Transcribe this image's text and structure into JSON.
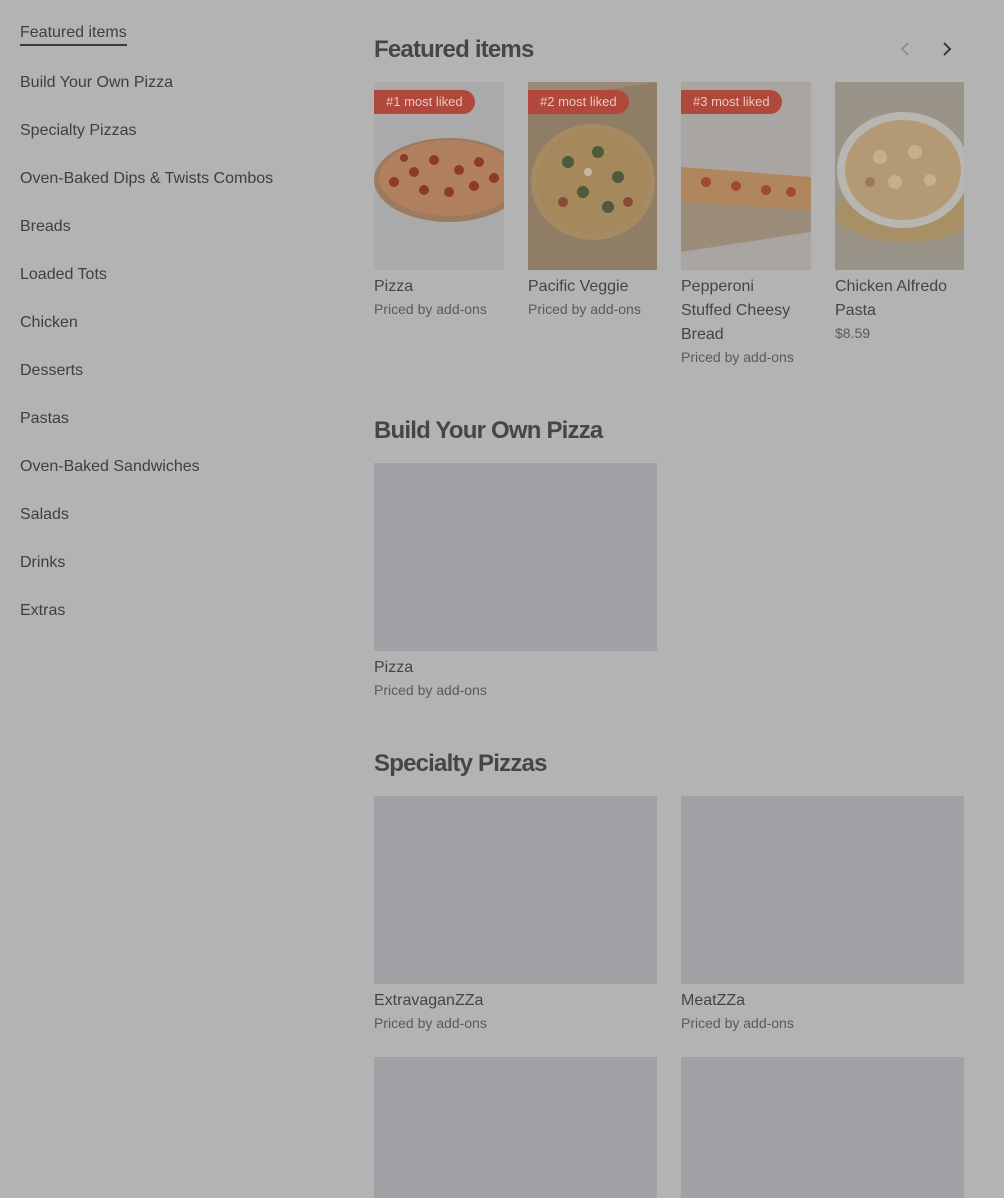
{
  "sidebar": {
    "items": [
      {
        "label": "Featured items"
      },
      {
        "label": "Build Your Own Pizza"
      },
      {
        "label": "Specialty Pizzas"
      },
      {
        "label": "Oven-Baked Dips & Twists Combos"
      },
      {
        "label": "Breads"
      },
      {
        "label": "Loaded Tots"
      },
      {
        "label": "Chicken"
      },
      {
        "label": "Desserts"
      },
      {
        "label": "Pastas"
      },
      {
        "label": "Oven-Baked Sandwiches"
      },
      {
        "label": "Salads"
      },
      {
        "label": "Drinks"
      },
      {
        "label": "Extras"
      }
    ]
  },
  "featured": {
    "title": "Featured items",
    "cards": [
      {
        "badge": "#1 most liked",
        "name": "Pizza",
        "price": "Priced by add-ons"
      },
      {
        "badge": "#2 most liked",
        "name": "Pacific Veggie",
        "price": "Priced by add-ons"
      },
      {
        "badge": "#3 most liked",
        "name_lines": [
          "Pepperoni",
          "Stuffed Cheesy",
          "Bread"
        ],
        "price": "Priced by add-ons"
      },
      {
        "name_lines": [
          "Chicken Alfredo",
          "Pasta"
        ],
        "price": "$8.59"
      }
    ]
  },
  "byo": {
    "title": "Build Your Own Pizza",
    "cards": [
      {
        "name": "Pizza",
        "price": "Priced by add-ons"
      }
    ]
  },
  "specialty": {
    "title": "Specialty Pizzas",
    "cards": [
      {
        "name": "ExtravaganZZa",
        "price": "Priced by add-ons"
      },
      {
        "name": "MeatZZa",
        "price": "Priced by add-ons"
      }
    ]
  },
  "colors": {
    "page_bg": "#b3b3b3",
    "badge_bg": "#b0483c",
    "placeholder": "#a0a1a4"
  }
}
